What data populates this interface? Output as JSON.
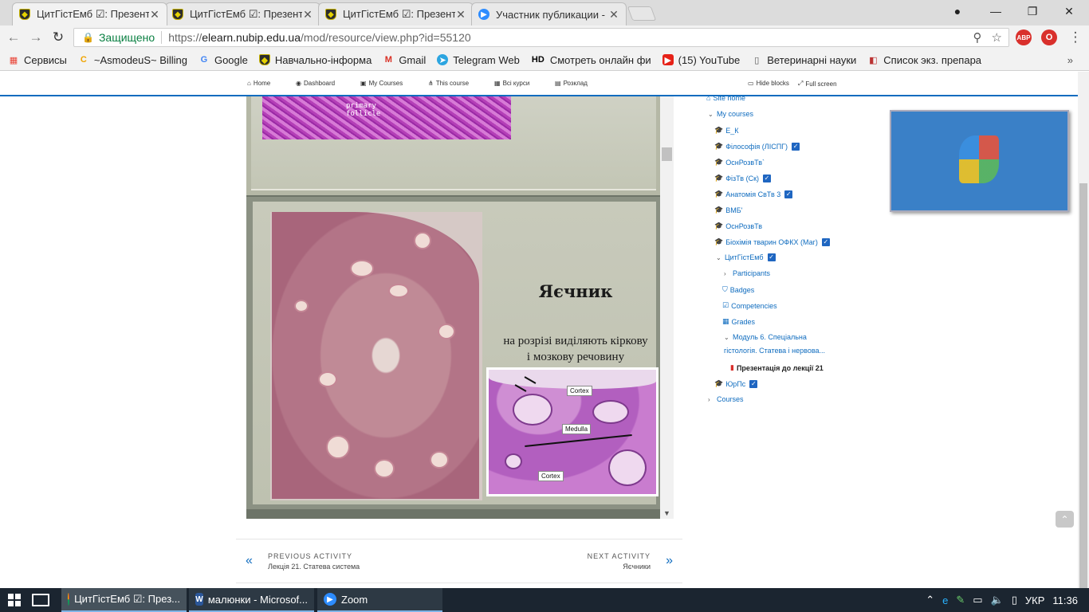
{
  "browser": {
    "tabs": [
      {
        "title": "ЦитГістЕмб ☑: Презент",
        "active": true,
        "favicon": "shield-favicon"
      },
      {
        "title": "ЦитГістЕмб ☑: Презент",
        "active": false,
        "favicon": "shield-favicon"
      },
      {
        "title": "ЦитГістЕмб ☑: Презент",
        "active": false,
        "favicon": "shield-favicon"
      },
      {
        "title": "Участник публикации -",
        "active": false,
        "favicon": "zoom-favicon"
      }
    ],
    "secure_label": "Защищено",
    "url_scheme": "https://",
    "url_host": "elearn.nubip.edu.ua",
    "url_path": "/mod/resource/view.php?id=55120",
    "extensions": [
      "ABP",
      "Opera"
    ]
  },
  "bookmarks": [
    {
      "label": "Сервисы",
      "icon": "apps-icon"
    },
    {
      "label": "~AsmodeuS~ Billing",
      "icon": "c-icon"
    },
    {
      "label": "Google",
      "icon": "google-icon"
    },
    {
      "label": "Навчально-інформа",
      "icon": "shield-icon"
    },
    {
      "label": "Gmail",
      "icon": "gmail-icon"
    },
    {
      "label": "Telegram Web",
      "icon": "telegram-icon"
    },
    {
      "label": "Смотреть онлайн фи",
      "icon": "hd-icon"
    },
    {
      "label": "(15) YouTube",
      "icon": "youtube-icon"
    },
    {
      "label": "Ветеринарні науки",
      "icon": "doc-icon"
    },
    {
      "label": "Список экз. препара",
      "icon": "bookmark-icon"
    }
  ],
  "moodle_nav": {
    "home": "Home",
    "dashboard": "Dashboard",
    "my_courses": "My Courses",
    "this_course": "This course",
    "all_courses": "Всі курси",
    "schedule": "Розклад",
    "hide_blocks": "Hide blocks",
    "full_screen": "Full screen"
  },
  "slide1": {
    "label_line1": "primary",
    "label_line2": "follicle"
  },
  "slide2": {
    "title": "Яєчник",
    "subtitle_line1": "на розрізі виділяють кіркову",
    "subtitle_line2": "і мозкову речовину",
    "inset_labels": {
      "cortex_top": "Cortex",
      "medulla": "Medulla",
      "cortex_bottom": "Cortex"
    }
  },
  "activity_nav": {
    "prev_heading": "PREVIOUS ACTIVITY",
    "prev_name": "Лекція 21. Статева система",
    "next_heading": "NEXT ACTIVITY",
    "next_name": "Яєчники"
  },
  "nav_tree": {
    "site_home": "Site home",
    "my_courses": "My courses",
    "courses": [
      {
        "label": "Е_К",
        "checked": false
      },
      {
        "label": "Філософія (ЛІСПГ)",
        "checked": true
      },
      {
        "label": "ОснРозвТв`",
        "checked": false
      },
      {
        "label": "ФізТв (Ск)",
        "checked": true
      },
      {
        "label": "Анатомія СвТв 3",
        "checked": true
      },
      {
        "label": "ВМБ'",
        "checked": false
      },
      {
        "label": "ОснРозвТв",
        "checked": false
      },
      {
        "label": "Біохімія тварин ОФКХ (Маг)",
        "checked": true
      }
    ],
    "current_course": "ЦитГістЕмб",
    "participants": "Participants",
    "badges": "Badges",
    "competencies": "Competencies",
    "grades": "Grades",
    "module_line1": "Модуль 6. Спеціальна",
    "module_line2": "гістологія. Статева і нервова...",
    "current_item": "Презентація до лекції 21",
    "last_course": "ЮрПс",
    "courses_link": "Courses"
  },
  "taskbar": {
    "apps": [
      {
        "label": "ЦитГістЕмб ☑: През...",
        "icon": "chrome-icon",
        "active": true
      },
      {
        "label": "малюнки - Microsof...",
        "icon": "word-icon",
        "active": false
      },
      {
        "label": "Zoom",
        "icon": "zoom-icon",
        "active": false
      }
    ],
    "language": "УКР",
    "time": "11:36"
  }
}
